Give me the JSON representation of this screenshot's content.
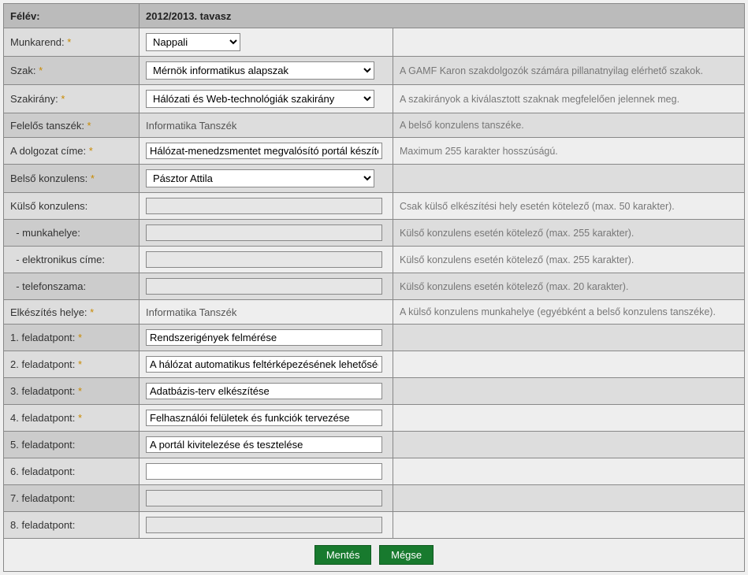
{
  "header": {
    "semester_label": "Félév:",
    "semester_value": "2012/2013. tavasz"
  },
  "rows": {
    "munkarend": {
      "label": "Munkarend: ",
      "req": "*",
      "value": "Nappali",
      "hint": ""
    },
    "szak": {
      "label": "Szak: ",
      "req": "*",
      "value": "Mérnök informatikus alapszak",
      "hint": "A GAMF Karon szakdolgozók számára pillanatnyilag elérhető szakok."
    },
    "szakirany": {
      "label": "Szakirány: ",
      "req": "*",
      "value": "Hálózati és Web-technológiák szakirány",
      "hint": "A szakirányok a kiválasztott szaknak megfelelően jelennek meg."
    },
    "tanszek": {
      "label": "Felelős tanszék: ",
      "req": "*",
      "value": "Informatika Tanszék",
      "hint": "A belső konzulens tanszéke."
    },
    "cim": {
      "label": "A dolgozat címe: ",
      "req": "*",
      "value": "Hálózat-menedzsmentet megvalósító portál készítése",
      "hint": "Maximum 255 karakter hosszúságú."
    },
    "belso": {
      "label": "Belső konzulens: ",
      "req": "*",
      "value": "Pásztor Attila",
      "hint": ""
    },
    "kulso": {
      "label": "Külső konzulens:",
      "value": "",
      "hint": "Csak külső elkészítési hely esetén kötelező (max. 50 karakter)."
    },
    "kulso_munka": {
      "label": "  - munkahelye:",
      "value": "",
      "hint": "Külső konzulens esetén kötelező (max. 255 karakter)."
    },
    "kulso_email": {
      "label": "  - elektronikus címe:",
      "value": "",
      "hint": "Külső konzulens esetén kötelező (max. 255 karakter)."
    },
    "kulso_tel": {
      "label": "  - telefonszama:",
      "value": "",
      "hint": "Külső konzulens esetén kötelező (max. 20 karakter)."
    },
    "hely": {
      "label": "Elkészítés helye: ",
      "req": "*",
      "value": "Informatika Tanszék",
      "hint": "A külső konzulens munkahelye (egyébként a belső konzulens tanszéke)."
    },
    "f1": {
      "label": "1. feladatpont: ",
      "req": "*",
      "value": "Rendszerigények felmérése"
    },
    "f2": {
      "label": "2. feladatpont: ",
      "req": "*",
      "value": "A hálózat automatikus feltérképezésének lehetősége"
    },
    "f3": {
      "label": "3. feladatpont: ",
      "req": "*",
      "value": "Adatbázis-terv elkészítése"
    },
    "f4": {
      "label": "4. feladatpont: ",
      "req": "*",
      "value": "Felhasználói felületek és funkciók tervezése"
    },
    "f5": {
      "label": "5. feladatpont:",
      "value": "A portál kivitelezése és tesztelése"
    },
    "f6": {
      "label": "6. feladatpont:",
      "value": ""
    },
    "f7": {
      "label": "7. feladatpont:",
      "value": ""
    },
    "f8": {
      "label": "8. feladatpont:",
      "value": ""
    }
  },
  "buttons": {
    "save": "Mentés",
    "cancel": "Mégse"
  }
}
